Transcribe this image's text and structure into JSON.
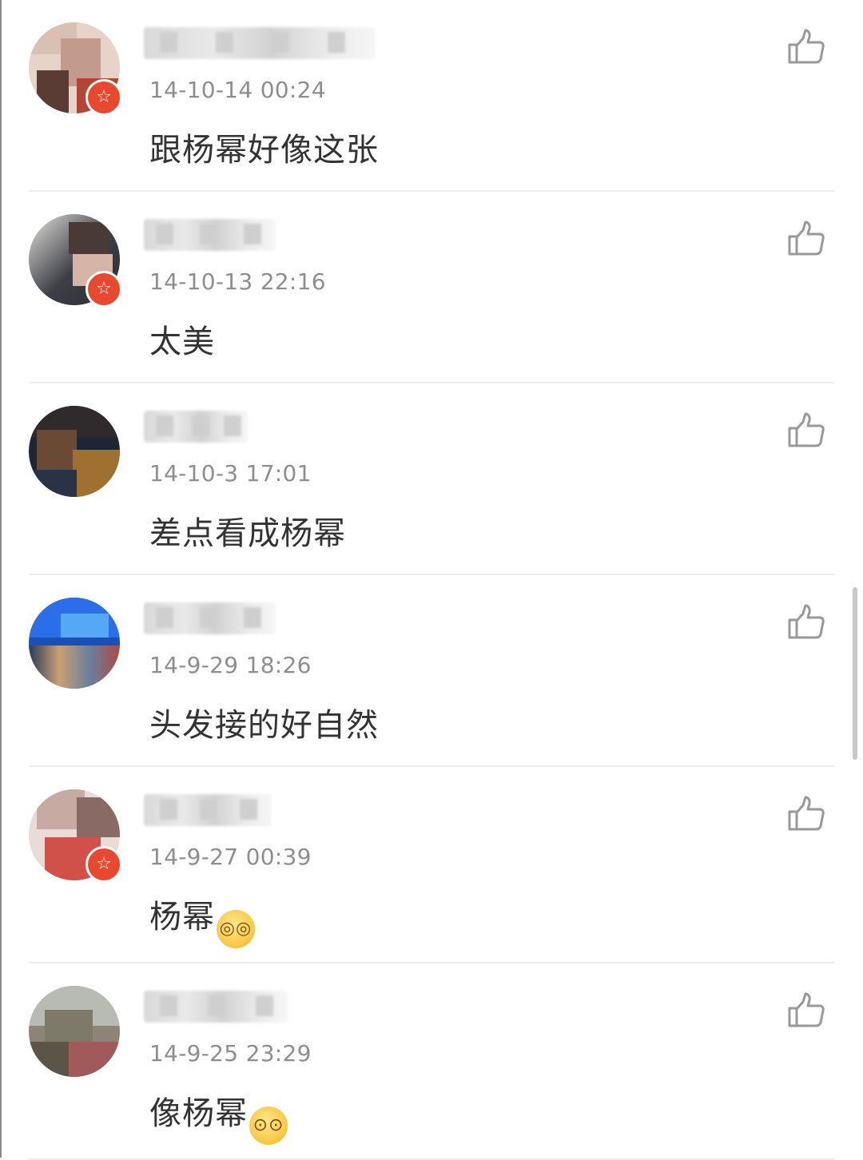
{
  "comments": [
    {
      "time": "14-10-14 00:24",
      "text": "跟杨幂好像这张",
      "emoji": "",
      "badge": "☆"
    },
    {
      "time": "14-10-13 22:16",
      "text": "太美",
      "emoji": "",
      "badge": "☆"
    },
    {
      "time": "14-10-3 17:01",
      "text": "差点看成杨幂",
      "emoji": ""
    },
    {
      "time": "14-9-29 18:26",
      "text": "头发接的好自然",
      "emoji": ""
    },
    {
      "time": "14-9-27 00:39",
      "text": "杨幂",
      "emoji": "dizzy-face-emoji",
      "badge": "☆"
    },
    {
      "time": "14-9-25 23:29",
      "text": "像杨幂",
      "emoji": "astonished-face-emoji"
    }
  ],
  "colors": {
    "badge": "#e8482e",
    "timestamp": "#8e8e8e",
    "text": "#333333",
    "divider": "#ececec",
    "like_icon": "#999999"
  }
}
